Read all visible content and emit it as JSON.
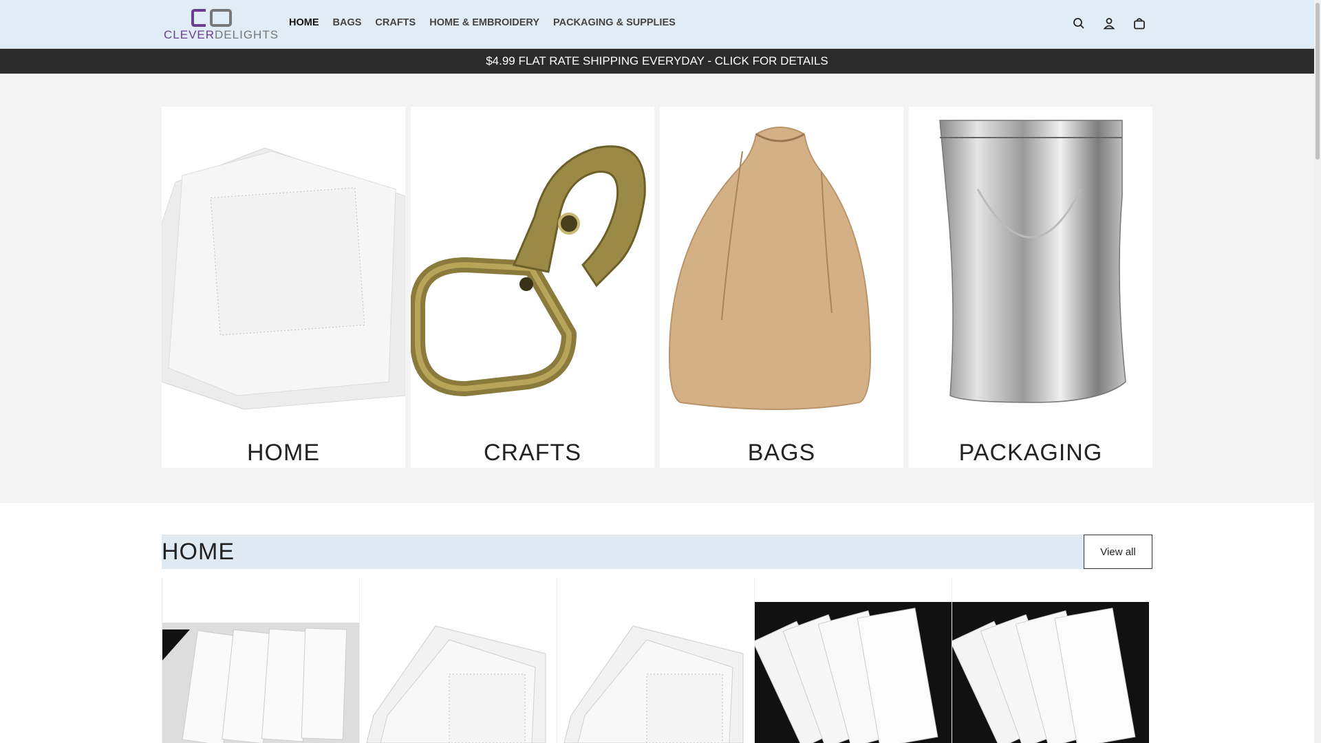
{
  "brand": {
    "logo_text_a": "CLEVER",
    "logo_text_b": "DELIGHTS"
  },
  "nav": {
    "items": [
      "HOME",
      "BAGS",
      "CRAFTS",
      "HOME & EMBROIDERY",
      "PACKAGING & SUPPLIES"
    ],
    "active": "HOME"
  },
  "header_icons": [
    "search-icon",
    "account-icon",
    "cart-icon"
  ],
  "announcement": "$4.99 FLAT RATE SHIPPING EVERYDAY - CLICK FOR DETAILS",
  "collections": [
    {
      "label": "HOME"
    },
    {
      "label": "CRAFTS"
    },
    {
      "label": "BAGS"
    },
    {
      "label": "PACKAGING"
    }
  ],
  "home_section": {
    "title": "HOME",
    "view_all": "View all"
  },
  "colors": {
    "header_bg": "#e0edf6",
    "announce_bg": "#2b2b2b",
    "brand_purple": "#6a3d8e"
  }
}
